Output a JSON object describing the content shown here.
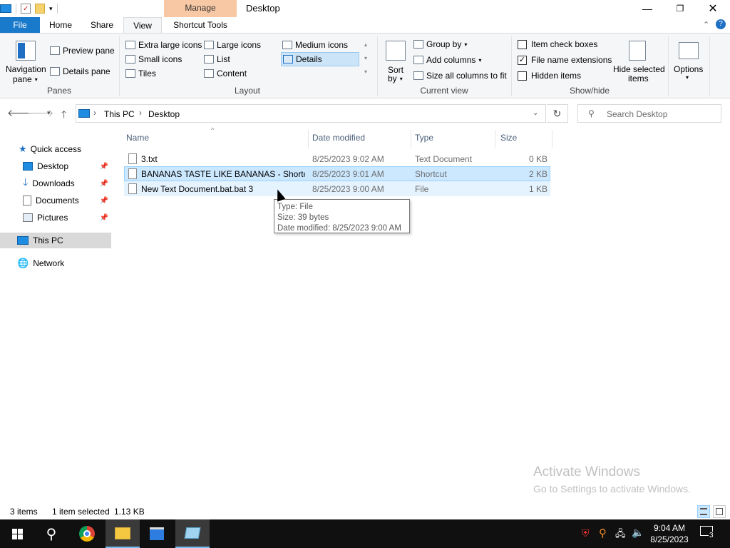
{
  "window": {
    "title": "Desktop",
    "context_tab": "Manage",
    "context_tab_color": "#f8c8a4",
    "controls": [
      "minimize-icon",
      "restore-icon",
      "close-icon"
    ]
  },
  "tabs": {
    "file": "File",
    "home": "Home",
    "share": "Share",
    "view": "View",
    "shortcut_tools": "Shortcut Tools"
  },
  "ribbon": {
    "panes": {
      "label": "Panes",
      "navigation_pane": "Navigation",
      "navigation_pane2": "pane",
      "preview_pane": "Preview pane",
      "details_pane": "Details pane"
    },
    "layout": {
      "label": "Layout",
      "extra_large": "Extra large icons",
      "large": "Large icons",
      "medium": "Medium icons",
      "small": "Small icons",
      "list": "List",
      "details": "Details",
      "tiles": "Tiles",
      "content": "Content"
    },
    "current_view": {
      "label": "Current view",
      "sort_by": "Sort",
      "sort_by2": "by",
      "group_by": "Group by",
      "add_columns": "Add columns",
      "size_all": "Size all columns to fit"
    },
    "show_hide": {
      "label": "Show/hide",
      "item_check_boxes": "Item check boxes",
      "item_check_boxes_checked": false,
      "file_name_extensions": "File name extensions",
      "file_name_extensions_checked": true,
      "hidden_items": "Hidden items",
      "hidden_items_checked": false,
      "hide_selected": "Hide selected",
      "hide_selected2": "items"
    },
    "options": "Options"
  },
  "address": {
    "crumbs": [
      "This PC",
      "Desktop"
    ],
    "search_placeholder": "Search Desktop"
  },
  "nav": {
    "quick_access": "Quick access",
    "items": [
      "Desktop",
      "Downloads",
      "Documents",
      "Pictures"
    ],
    "this_pc": "This PC",
    "network": "Network"
  },
  "columns": [
    "Name",
    "Date modified",
    "Type",
    "Size"
  ],
  "files": [
    {
      "name": "3.txt",
      "date": "8/25/2023 9:02 AM",
      "type": "Text Document",
      "size": "0 KB"
    },
    {
      "name": "BANANAS TASTE LIKE BANANAS - Shortc...",
      "date": "8/25/2023 9:01 AM",
      "type": "Shortcut",
      "size": "2 KB"
    },
    {
      "name": "New Text Document.bat.bat 3",
      "date": "8/25/2023 9:00 AM",
      "type": "File",
      "size": "1 KB"
    }
  ],
  "tooltip": {
    "type": "Type: File",
    "size": "Size: 39 bytes",
    "date": "Date modified: 8/25/2023 9:00 AM"
  },
  "watermark": {
    "line1": "Activate Windows",
    "line2": "Go to Settings to activate Windows."
  },
  "status": {
    "items": "3 items",
    "selected": "1 item selected",
    "size": "1.13 KB"
  },
  "taskbar": {
    "time": "9:04 AM",
    "date": "8/25/2023",
    "notifications": "3"
  },
  "colors": {
    "file_tab": "#1979ca",
    "selection": "#cce8ff",
    "taskbar": "#101010"
  }
}
